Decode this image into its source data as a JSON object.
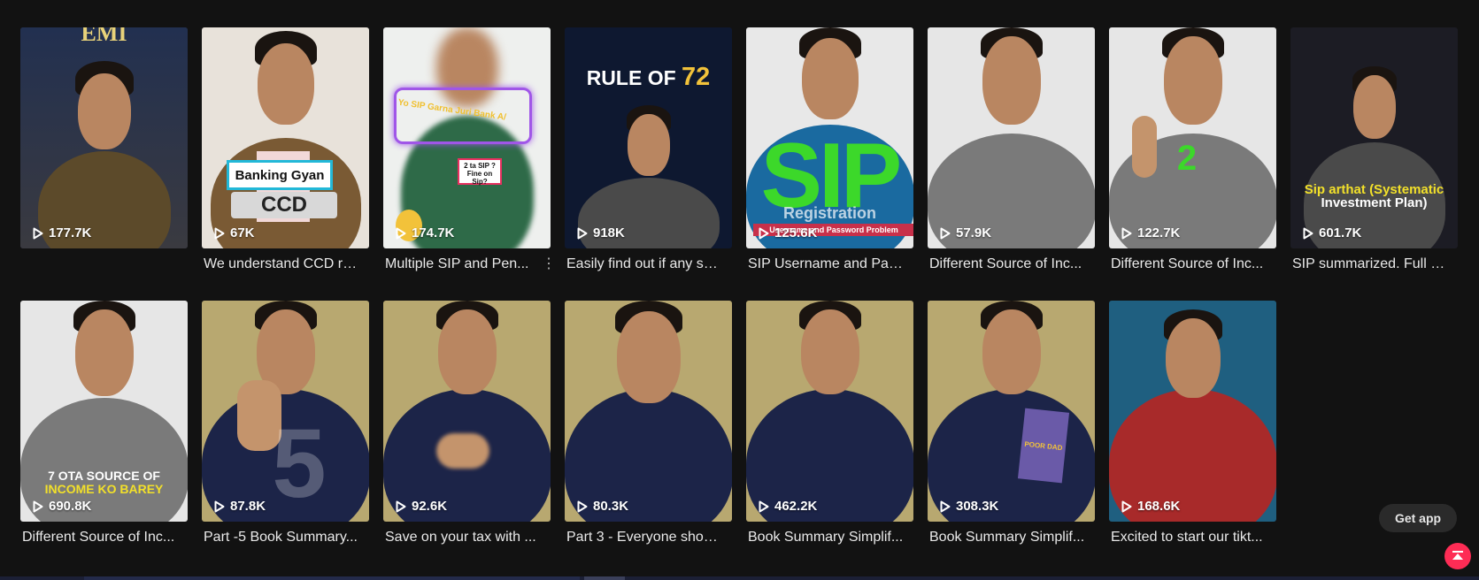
{
  "videos": [
    {
      "views": "177.7K",
      "caption": "",
      "overlay": "EMI",
      "bg": "#2a3550",
      "shirt": "#5c4a2a"
    },
    {
      "views": "67K",
      "caption": "We understand CCD ra...",
      "overlay": "Banking Gyan",
      "overlay2": "CCD",
      "bg": "#e8e2da",
      "shirt": "#7a5a34"
    },
    {
      "views": "174.7K",
      "caption": "Multiple SIP and Pen...",
      "overlay": "Yo SIP Garna Juri Bank A/",
      "overlay2": "2 ta SIP ? Fine on Sip?",
      "bg": "#eef0ee",
      "shirt": "#2e6a48"
    },
    {
      "views": "918K",
      "caption": "Easily find out if any sc...",
      "overlay": "RULE OF",
      "overlay_num": "72",
      "bg": "#0e1830",
      "shirt": "#4a4a4a"
    },
    {
      "views": "125.6K",
      "caption": "SIP Username and Pas...",
      "overlay": "SIP",
      "overlay2": "Registration",
      "overlay3": "Username and Password Problem",
      "bg": "#e8e8e8",
      "shirt": "#1a6aa0"
    },
    {
      "views": "57.9K",
      "caption": "Different Source of Inc...",
      "overlay": "",
      "bg": "#e6e6e6",
      "shirt": "#7a7a7a"
    },
    {
      "views": "122.7K",
      "caption": "Different Source of Inc...",
      "overlay": "2",
      "bg": "#e6e6e6",
      "shirt": "#7a7a7a"
    },
    {
      "views": "601.7K",
      "caption": "SIP summarized. Full d...",
      "overlay": "Sip arthat (Systematic",
      "overlay2": "Investment Plan)",
      "bg": "#1c1c24",
      "shirt": "#4a4a4a"
    },
    {
      "views": "690.8K",
      "caption": "Different Source of Inc...",
      "overlay": "7 OTA SOURCE OF",
      "overlay2": "INCOME KO BAREY",
      "bg": "#e6e6e6",
      "shirt": "#7a7a7a"
    },
    {
      "views": "87.8K",
      "caption": "Part -5 Book Summary...",
      "overlay": "5",
      "bg": "#b8a870",
      "shirt": "#1c2448"
    },
    {
      "views": "92.6K",
      "caption": "Save on your tax with ...",
      "overlay": "",
      "bg": "#b8a870",
      "shirt": "#1c2448"
    },
    {
      "views": "80.3K",
      "caption": "Part 3 - Everyone shou...",
      "overlay": "",
      "bg": "#b8a870",
      "shirt": "#1c2448"
    },
    {
      "views": "462.2K",
      "caption": "Book Summary Simplif...",
      "overlay": "",
      "bg": "#b8a870",
      "shirt": "#1c2448"
    },
    {
      "views": "308.3K",
      "caption": "Book Summary Simplif...",
      "overlay": "POOR DAD",
      "bg": "#b8a870",
      "shirt": "#1c2448"
    },
    {
      "views": "168.6K",
      "caption": "Excited to start our tikt...",
      "overlay": "",
      "bg": "#1f5f80",
      "shirt": "#a82a2a"
    }
  ],
  "get_app_label": "Get app",
  "colors": {
    "accent": "#fe2c55",
    "background": "#121212"
  }
}
